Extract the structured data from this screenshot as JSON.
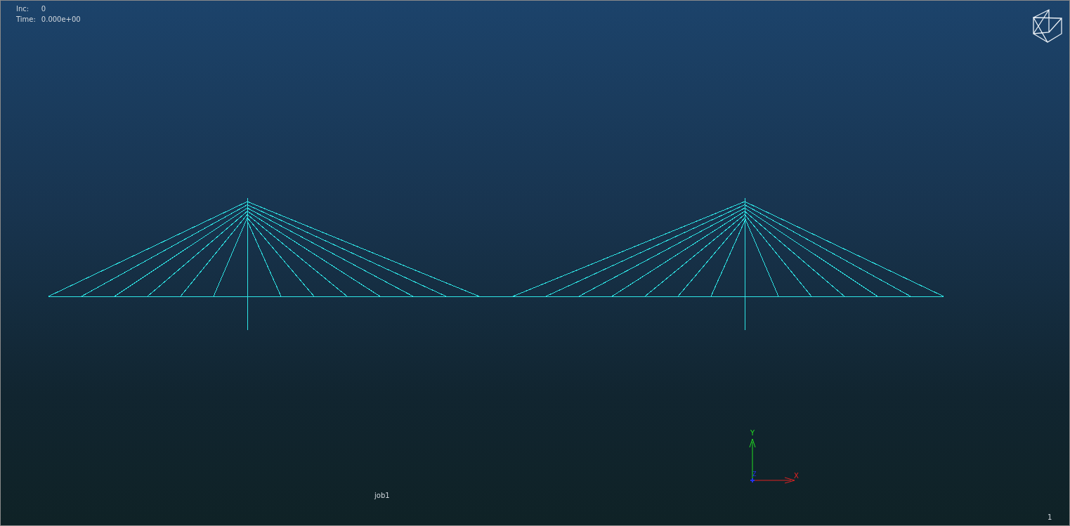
{
  "viewport": {
    "info": [
      {
        "label": "Inc:",
        "value": "0"
      },
      {
        "label": "Time:",
        "value": "0.000e+00"
      }
    ],
    "job_name": "job1",
    "page_number": "1",
    "axes": {
      "x": "X",
      "y": "Y",
      "z": "Z"
    }
  }
}
